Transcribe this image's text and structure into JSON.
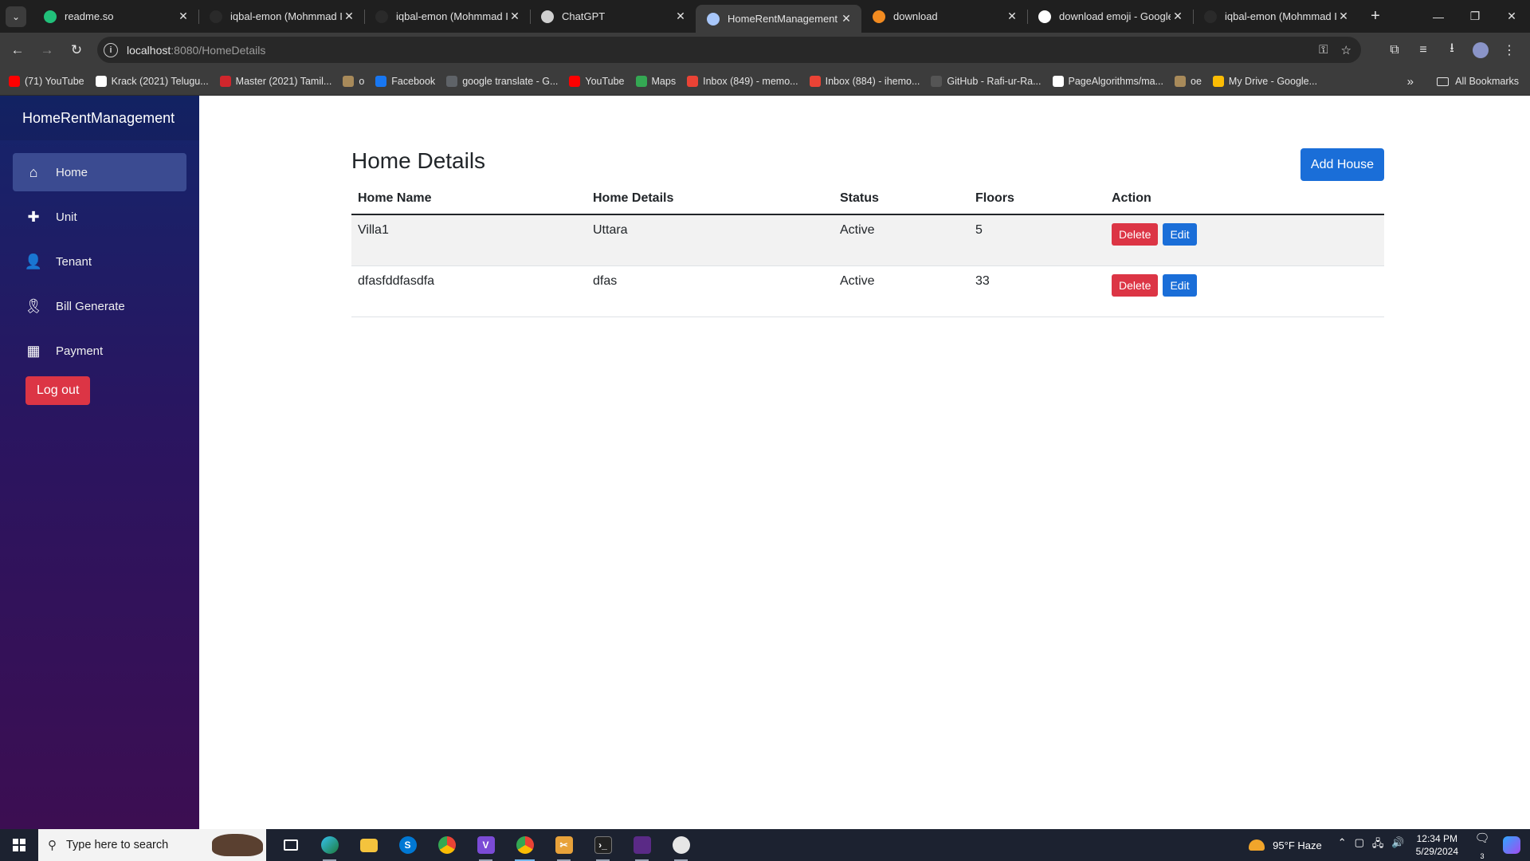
{
  "browser": {
    "tabs": [
      {
        "title": "readme.so",
        "icon": "readme-icon",
        "color": "#21c07a",
        "active": false
      },
      {
        "title": "iqbal-emon (Mohmmad I",
        "icon": "github-icon",
        "color": "#2a2a2a",
        "active": false
      },
      {
        "title": "iqbal-emon (Mohmmad I",
        "icon": "github-icon",
        "color": "#2a2a2a",
        "active": false
      },
      {
        "title": "ChatGPT",
        "icon": "chatgpt-icon",
        "color": "#cfcfcf",
        "active": false
      },
      {
        "title": "HomeRentManagement",
        "icon": "page-icon",
        "color": "#a8c7fa",
        "active": true
      },
      {
        "title": "download",
        "icon": "download-page-icon",
        "color": "#f28b20",
        "active": false
      },
      {
        "title": "download emoji - Google",
        "icon": "google-icon",
        "color": "#ffffff",
        "active": false
      },
      {
        "title": "iqbal-emon (Mohmmad I",
        "icon": "github-icon",
        "color": "#2a2a2a",
        "active": false
      }
    ],
    "url_host": "localhost",
    "url_path": ":8080/HomeDetails",
    "bookmarks": [
      {
        "label": "(71) YouTube",
        "color": "#ff0000"
      },
      {
        "label": "Krack (2021) Telugu...",
        "color": "#ffffff"
      },
      {
        "label": "Master (2021) Tamil...",
        "color": "#d0262c"
      },
      {
        "label": "o",
        "color": "#a88a5a"
      },
      {
        "label": "Facebook",
        "color": "#1877f2"
      },
      {
        "label": "google translate - G...",
        "color": "#5f6368"
      },
      {
        "label": "YouTube",
        "color": "#ff0000"
      },
      {
        "label": "Maps",
        "color": "#34a853"
      },
      {
        "label": "Inbox (849) - memo...",
        "color": "#ea4335"
      },
      {
        "label": "Inbox (884) - ihemo...",
        "color": "#ea4335"
      },
      {
        "label": "GitHub - Rafi-ur-Ra...",
        "color": "#555555"
      },
      {
        "label": "PageAlgorithms/ma...",
        "color": "#ffffff"
      },
      {
        "label": "oe",
        "color": "#a88a5a"
      },
      {
        "label": "My Drive - Google...",
        "color": "#fbbc04"
      }
    ],
    "all_bookmarks": "All Bookmarks"
  },
  "sidebar": {
    "brand": "HomeRentManagement",
    "items": [
      {
        "label": "Home",
        "icon": "home-icon",
        "glyph": "⌂",
        "active": true
      },
      {
        "label": "Unit",
        "icon": "plus-icon",
        "glyph": "✚",
        "active": false
      },
      {
        "label": "Tenant",
        "icon": "user-icon",
        "glyph": "👤",
        "active": false
      },
      {
        "label": "Bill Generate",
        "icon": "ribbon-icon",
        "glyph": "🎗",
        "active": false
      },
      {
        "label": "Payment",
        "icon": "calculator-icon",
        "glyph": "▦",
        "active": false
      }
    ],
    "logout": "Log out"
  },
  "main": {
    "title": "Home Details",
    "add_button": "Add House",
    "columns": [
      "Home Name",
      "Home Details",
      "Status",
      "Floors",
      "Action"
    ],
    "rows": [
      {
        "name": "Villa1",
        "details": "Uttara",
        "status": "Active",
        "floors": "5"
      },
      {
        "name": "dfasfddfasdfa",
        "details": "dfas",
        "status": "Active",
        "floors": "33"
      }
    ],
    "delete_label": "Delete",
    "edit_label": "Edit"
  },
  "taskbar": {
    "search_placeholder": "Type here to search",
    "weather": "95°F  Haze",
    "time": "12:34 PM",
    "date": "5/29/2024",
    "notification_count": "3"
  }
}
